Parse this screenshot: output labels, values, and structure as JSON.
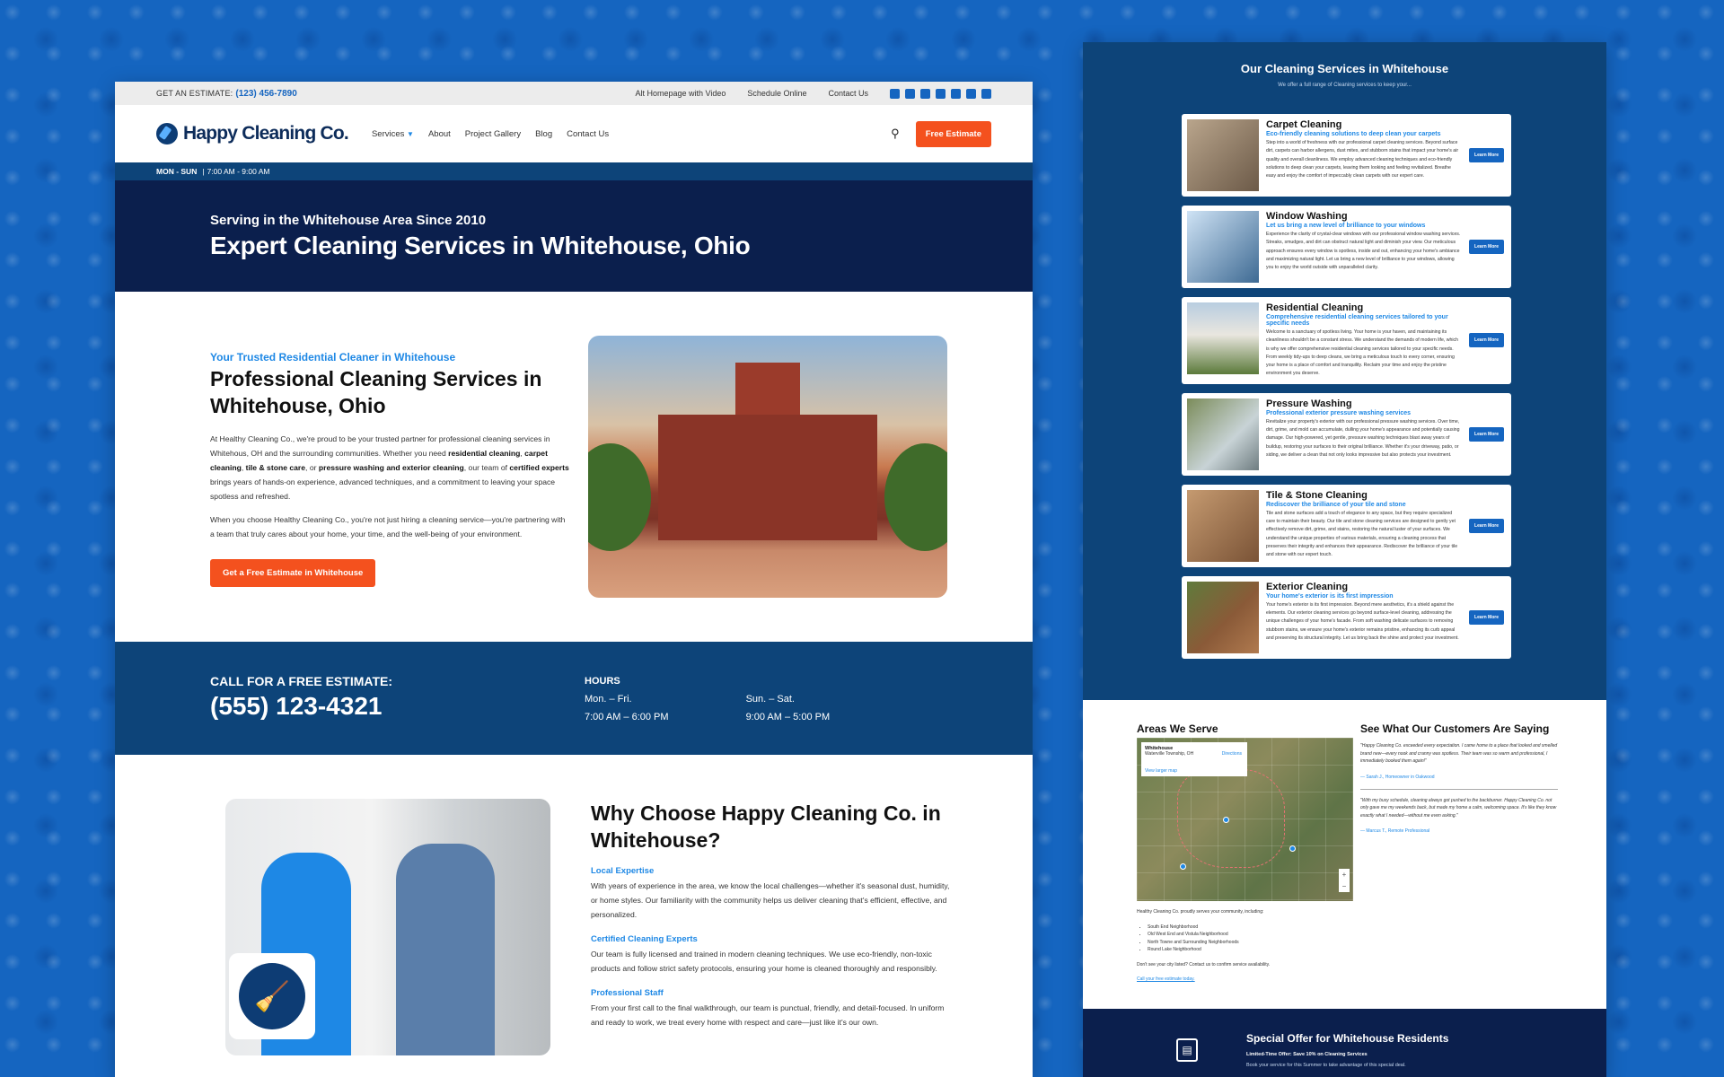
{
  "topbar": {
    "estimate_label": "GET AN ESTIMATE:",
    "phone": "(123) 456-7890",
    "links": [
      "Alt Homepage with Video",
      "Schedule Online",
      "Contact Us"
    ],
    "socials": [
      "facebook-icon",
      "x-icon",
      "instagram-icon",
      "youtube-icon",
      "linkedin-icon",
      "yelp-icon",
      "tiktok-icon"
    ]
  },
  "nav": {
    "logo": "Happy Cleaning Co.",
    "menu": [
      "Services",
      "About",
      "Project Gallery",
      "Blog",
      "Contact Us"
    ],
    "cta": "Free Estimate"
  },
  "hoursbar": {
    "days": "MON - SUN",
    "sep": "|",
    "time": "7:00 AM - 9:00 AM"
  },
  "hero": {
    "sub": "Serving in the Whitehouse Area Since 2010",
    "title": "Expert Cleaning Services in Whitehouse, Ohio"
  },
  "intro": {
    "eyebrow": "Your Trusted Residential Cleaner in Whitehouse",
    "title": "Professional Cleaning Services in Whitehouse, Ohio",
    "p1a": "At Healthy Cleaning Co., we're proud to be your trusted partner for professional cleaning services in Whitehous, OH and the surrounding communities. Whether you need ",
    "b1": "residential cleaning",
    "p1b": ", ",
    "b2": "carpet cleaning",
    "p1c": ", ",
    "b3": "tile & stone care",
    "p1d": ", or ",
    "b4": "pressure washing and exterior cleaning",
    "p1e": ", our team of ",
    "b5": "certified experts",
    "p1f": " brings years of hands-on experience, advanced techniques, and a commitment to leaving your space spotless and refreshed.",
    "p2": "When you choose Healthy Cleaning Co., you're not just hiring a cleaning service—you're partnering with a team that truly cares about your home, your time, and the well-being of your environment.",
    "cta": "Get a Free Estimate in Whitehouse"
  },
  "estimate": {
    "label": "CALL FOR A FREE ESTIMATE:",
    "phone": "(555) 123-4321",
    "hours_label": "HOURS",
    "col1_days": "Mon. – Fri.",
    "col1_time": "7:00 AM – 6:00 PM",
    "col2_days": "Sun. – Sat.",
    "col2_time": "9:00 AM – 5:00 PM"
  },
  "why": {
    "title": "Why Choose Happy Cleaning Co. in Whitehouse?",
    "features": [
      {
        "t": "Local Expertise",
        "d": "With years of experience in the area, we know the local challenges—whether it's seasonal dust, humidity, or home styles. Our familiarity with the community helps us deliver cleaning that's efficient, effective, and personalized."
      },
      {
        "t": "Certified Cleaning Experts",
        "d": "Our team is fully licensed and trained in modern cleaning techniques. We use eco-friendly, non-toxic products and follow strict safety protocols, ensuring your home is cleaned thoroughly and responsibly."
      },
      {
        "t": "Professional Staff",
        "d": "From your first call to the final walkthrough, our team is punctual, friendly, and detail-focused. In uniform and ready to work, we treat every home with respect and care—just like it's our own."
      }
    ]
  },
  "services": {
    "title": "Our Cleaning Services in Whitehouse",
    "subtitle": "We offer a full range of Cleaning services to keep your...",
    "button": "Learn More",
    "items": [
      {
        "t": "Carpet Cleaning",
        "s": "Eco-friendly cleaning solutions to deep clean your carpets",
        "d": "Step into a world of freshness with our professional carpet cleaning services. Beyond surface dirt, carpets can harbor allergens, dust mites, and stubborn stains that impact your home's air quality and overall cleanliness. We employ advanced cleaning techniques and eco-friendly solutions to deep clean your carpets, leaving them looking and feeling revitalized. Breathe easy and enjoy the comfort of impeccably clean carpets with our expert care."
      },
      {
        "t": "Window Washing",
        "s": "Let us bring a new level of brilliance to your windows",
        "d": "Experience the clarity of crystal-clear windows with our professional window washing services. Streaks, smudges, and dirt can obstruct natural light and diminish your view. Our meticulous approach ensures every window is spotless, inside and out, enhancing your home's ambiance and maximizing natural light. Let us bring a new level of brilliance to your windows, allowing you to enjoy the world outside with unparalleled clarity."
      },
      {
        "t": "Residential Cleaning",
        "s": "Comprehensive residential cleaning services tailored to your specific needs",
        "d": "Welcome to a sanctuary of spotless living. Your home is your haven, and maintaining its cleanliness shouldn't be a constant stress. We understand the demands of modern life, which is why we offer comprehensive residential cleaning services tailored to your specific needs. From weekly tidy-ups to deep cleans, we bring a meticulous touch to every corner, ensuring your home is a place of comfort and tranquility. Reclaim your time and enjoy the pristine environment you deserve."
      },
      {
        "t": "Pressure Washing",
        "s": "Professional exterior pressure washing services",
        "d": "Revitalize your property's exterior with our professional pressure washing services. Over time, dirt, grime, and mold can accumulate, dulling your home's appearance and potentially causing damage. Our high-powered, yet gentle, pressure washing techniques blast away years of buildup, restoring your surfaces to their original brilliance. Whether it's your driveway, patio, or siding, we deliver a clean that not only looks impressive but also protects your investment."
      },
      {
        "t": "Tile & Stone Cleaning",
        "s": "Rediscover the brilliance of your tile and stone",
        "d": "Tile and stone surfaces add a touch of elegance to any space, but they require specialized care to maintain their beauty. Our tile and stone cleaning services are designed to gently yet effectively remove dirt, grime, and stains, restoring the natural luster of your surfaces. We understand the unique properties of various materials, ensuring a cleaning process that preserves their integrity and enhances their appearance. Rediscover the brilliance of your tile and stone with our expert touch."
      },
      {
        "t": "Exterior Cleaning",
        "s": "Your home's exterior is its first impression",
        "d": "Your home's exterior is its first impression. Beyond mere aesthetics, it's a shield against the elements. Our exterior cleaning services go beyond surface-level cleaning, addressing the unique challenges of your home's facade. From soft washing delicate surfaces to removing stubborn stains, we ensure your home's exterior remains pristine, enhancing its curb appeal and preserving its structural integrity. Let us bring back the shine and protect your investment."
      }
    ]
  },
  "areas": {
    "title": "Areas We Serve",
    "map_place": "Whitehouse",
    "map_sub": "Waterville Township, OH",
    "map_dir": "Directions",
    "map_larger": "View larger map",
    "intro": "Healthy Cleaning Co. proudly serves your community, including:",
    "list": [
      "South End Neighborhood",
      "Old West End and Vistula Neighborhood",
      "North Towne and Surrounding Neighborhoods",
      "Round Lake Neighborhood"
    ],
    "note": "Don't see your city listed? Contact us to confirm service availability.",
    "link": "Call your free estimate today."
  },
  "reviews": {
    "title": "See What Our Customers Are Saying",
    "items": [
      {
        "q": "\"Happy Cleaning Co. exceeded every expectation. I came home to a place that looked and smelled brand new—every nook and cranny was spotless. Their team was so warm and professional, I immediately booked them again!\"",
        "a": "— Sarah J., Homeowner in Oakwood"
      },
      {
        "q": "\"With my busy schedule, cleaning always got pushed to the backburner. Happy Cleaning Co. not only gave me my weekends back, but made my home a calm, welcoming space. It's like they know exactly what I needed—without me even asking.\"",
        "a": "— Marcus T., Remote Professional"
      }
    ]
  },
  "offer": {
    "title": "Special Offer for Whitehouse Residents",
    "line1": "Limited-Time Offer: Save 10% on Cleaning Services",
    "line2": "Book your service for this Summer to take advantage of this special deal."
  },
  "colors": {
    "brand_blue": "#0d4479",
    "navy": "#0b1f4d",
    "accent_orange": "#f4511e",
    "link_blue": "#1e88e5"
  }
}
